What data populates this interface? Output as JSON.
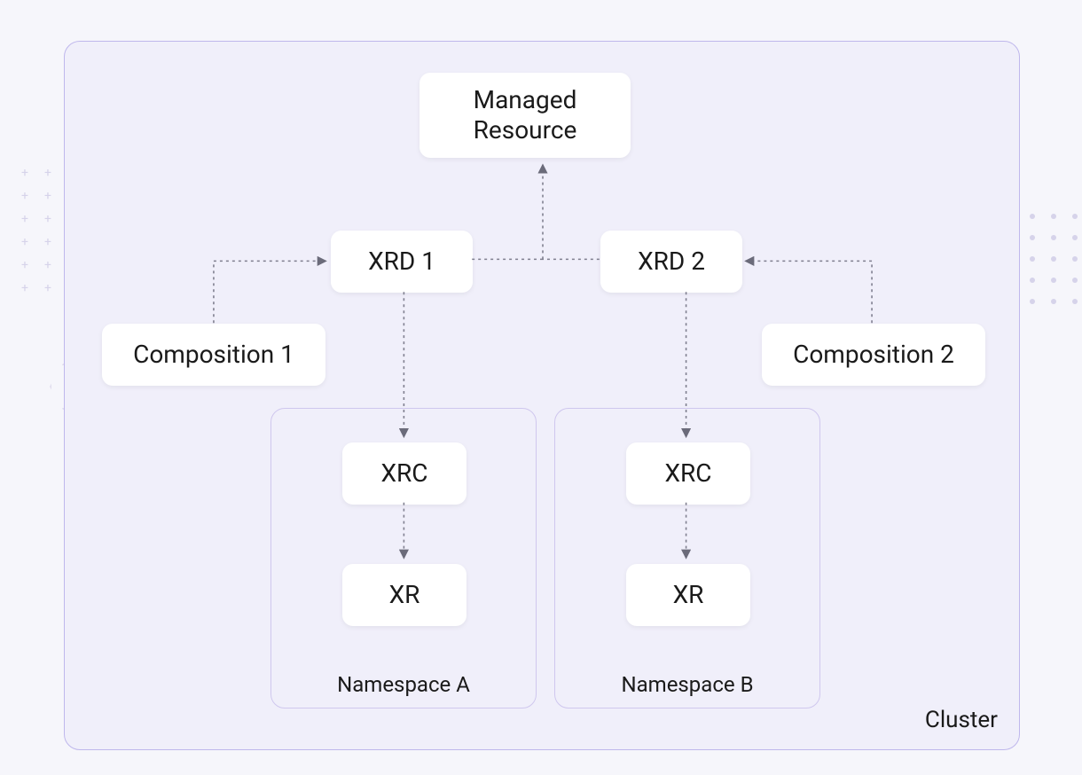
{
  "clusterLabel": "Cluster",
  "nodes": {
    "managedResource": "Managed\nResource",
    "xrd1": "XRD 1",
    "xrd2": "XRD 2",
    "composition1": "Composition 1",
    "composition2": "Composition 2",
    "xrc_a": "XRC",
    "xr_a": "XR",
    "xrc_b": "XRC",
    "xr_b": "XR"
  },
  "namespaces": {
    "a": "Namespace A",
    "b": "Namespace B"
  }
}
